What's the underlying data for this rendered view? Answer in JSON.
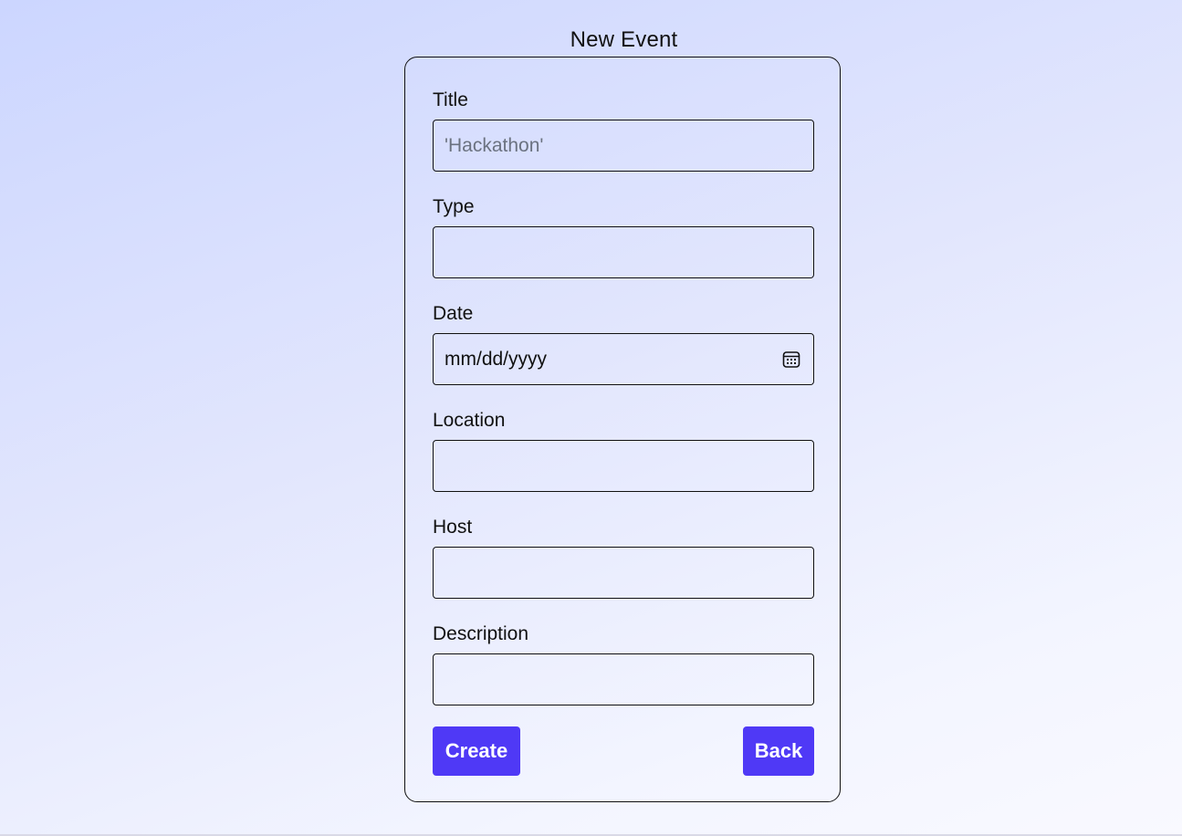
{
  "page": {
    "title": "New Event"
  },
  "form": {
    "fields": [
      {
        "label": "Title",
        "placeholder": "'Hackathon'",
        "value": ""
      },
      {
        "label": "Type",
        "placeholder": "",
        "value": ""
      },
      {
        "label": "Date",
        "placeholder": "mm/dd/yyyy",
        "value": ""
      },
      {
        "label": "Location",
        "placeholder": "",
        "value": ""
      },
      {
        "label": "Host",
        "placeholder": "",
        "value": ""
      },
      {
        "label": "Description",
        "placeholder": "",
        "value": ""
      }
    ],
    "date_icon": "calendar-icon",
    "create_label": "Create",
    "back_label": "Back"
  },
  "colors": {
    "button_bg": "#4f39f6",
    "button_text": "#ffffff",
    "border": "#111111",
    "placeholder": "#6b7280"
  }
}
